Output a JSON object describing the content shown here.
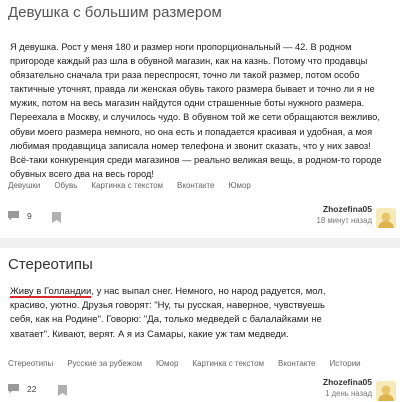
{
  "posts": [
    {
      "title": "Девушка с большим размером",
      "body": "Я девушка. Рост у меня 180 и размер ноги пропорциональный — 42. В родном пригороде каждый раз шла в обувной магазин, как на казнь. Потому что продавцы обязательно сначала три раза переспросят, точно ли такой размер, потом особо тактичные уточнят, правда ли женская обувь такого размера бывает и точно ли я не мужик, потом на весь магазин найдутся одни страшенные боты нужного размера. Переехала в Москву, и случилось чудо. В обувном той же сети обращаются вежливо, обуви моего размера немного, но она есть и попадается красивая и удобная, а моя любимая продавщица записала номер телефона и звонит сказать, что у них завоз! Всё-таки конкуренция среди магазинов — реально великая вещь, в родном-то городе обувных всего два на весь город!",
      "tags": [
        "Девушки",
        "Обувь",
        "Картинка с текстом",
        "Вконтакте",
        "Юмор"
      ],
      "comments": "9",
      "author": "Zhozefina05",
      "time": "18 минут назад"
    },
    {
      "title": "Стереотипы",
      "body_highlight": "Живу в Голландии",
      "body_rest": ", у нас выпал снег. Немного, но народ радуется, мол, красиво, уютно. Друзья говорят: \"Ну, ты русская, наверное, чувствуешь себя, как на Родине\". Говорю: \"Да, только медведей с балалайками не хватает\". Кивают, верят. А я из Самары, какие уж там медведи.",
      "tags": [
        "Стереотипы",
        "Русские за рубежом",
        "Юмор",
        "Картинка с текстом",
        "Вконтакте",
        "Истории"
      ],
      "comments": "22",
      "author": "Zhozefina05",
      "time": "1 день назад"
    }
  ],
  "icons": {
    "comment": "comment-icon",
    "save": "bookmark-icon",
    "avatar": "author-avatar"
  },
  "colors": {
    "highlight_underline": "#d9292e",
    "separator": "#f0f0f0",
    "meta_text": "#666666"
  }
}
